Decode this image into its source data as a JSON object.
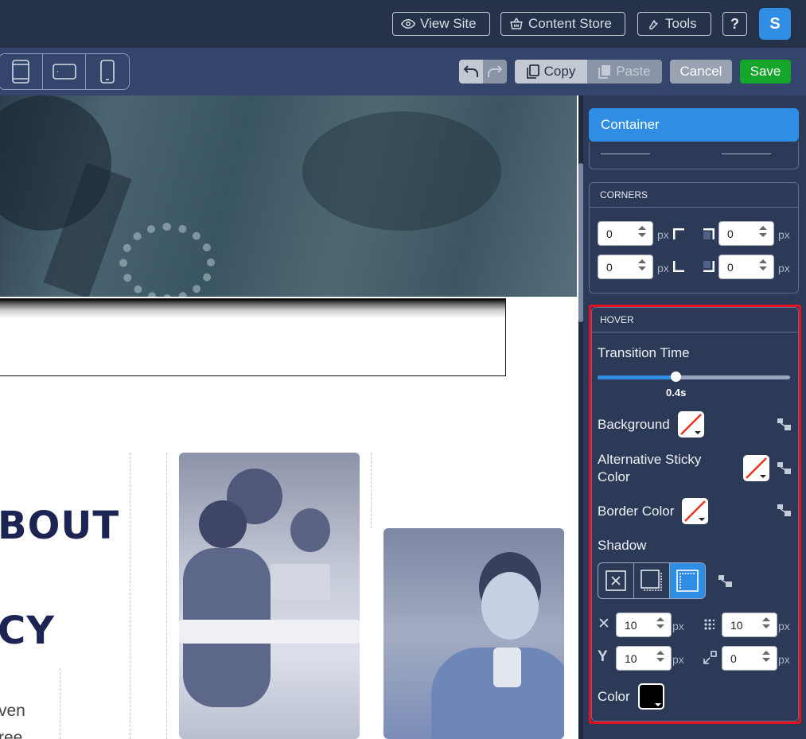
{
  "topbar": {
    "view_site": "View Site",
    "content_store": "Content Store",
    "tools": "Tools",
    "help": "?",
    "avatar_initial": "S"
  },
  "toolbar": {
    "copy": "Copy",
    "paste": "Paste",
    "cancel": "Cancel",
    "save": "Save"
  },
  "canvas": {
    "headline_1": "BOUT",
    "headline_2": "CY",
    "body_1": "ven",
    "body_2": "ree"
  },
  "panel": {
    "container_title": "Container",
    "corners": {
      "title": "CORNERS",
      "top_left": "0",
      "top_right": "0",
      "bottom_left": "0",
      "bottom_right": "0",
      "unit": "px"
    },
    "hover": {
      "title": "HOVER",
      "transition_label": "Transition Time",
      "transition_value": "0.4s",
      "transition_fraction": 0.4,
      "background_label": "Background",
      "alt_sticky_label": "Alternative Sticky Color",
      "border_color_label": "Border Color",
      "shadow_label": "Shadow",
      "shadow_x": "10",
      "shadow_y": "10",
      "shadow_blur": "10",
      "shadow_spread": "0",
      "unit": "px",
      "color_label": "Color",
      "color_value": "#000000"
    }
  },
  "colors": {
    "topbar": "#253249",
    "toolbar": "#33456a",
    "panel": "#2c3a58",
    "accent": "#2f8de4",
    "save": "#15a52a",
    "highlight": "#e8101c"
  }
}
